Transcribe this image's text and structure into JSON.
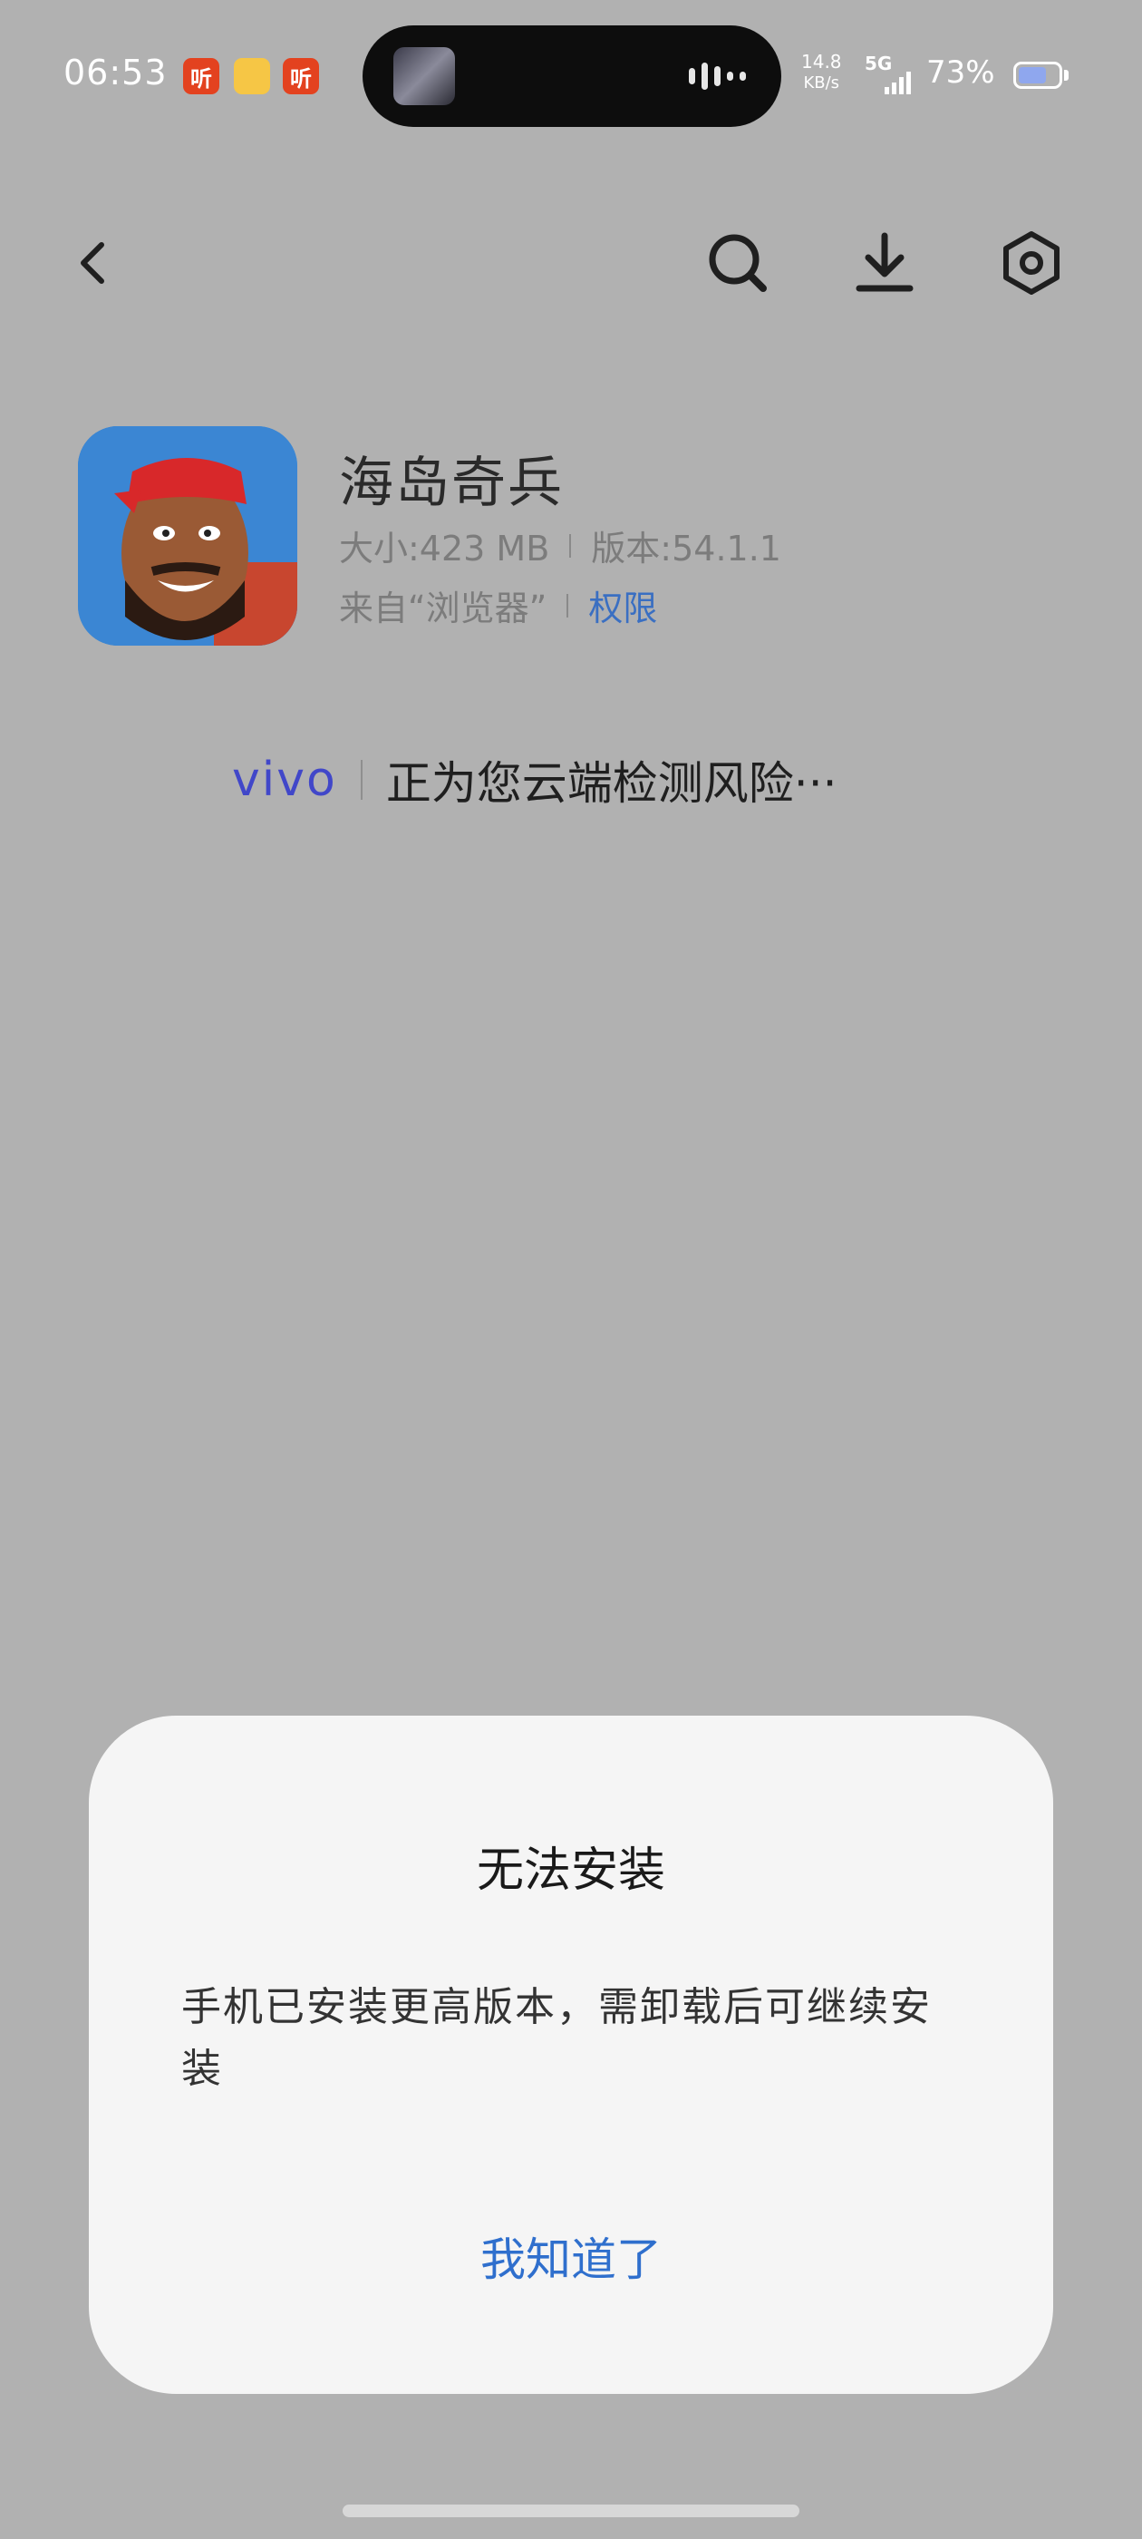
{
  "status_bar": {
    "time": "06:53",
    "notifications": [
      {
        "icon": "ting-app-icon",
        "label": "听"
      },
      {
        "icon": "note-app-icon",
        "label": ""
      },
      {
        "icon": "ting-app-icon",
        "label": "听"
      }
    ],
    "net_speed_value": "14.8",
    "net_speed_unit": "KB/s",
    "network": "5G",
    "battery_percent": "73%"
  },
  "header": {
    "back_icon": "chevron-left-icon",
    "search_icon": "search-icon",
    "download_icon": "download-icon",
    "settings_icon": "hex-settings-icon"
  },
  "app": {
    "name": "海岛奇兵",
    "size": "大小:423 MB",
    "version": "版本:54.1.1",
    "source": "来自“浏览器”",
    "permissions_label": "权限"
  },
  "scan": {
    "brand": "vivo",
    "status_text": "正为您云端检测风险···"
  },
  "dialog": {
    "title": "无法安装",
    "message": "手机已安装更高版本，需卸载后可继续安装",
    "ok_label": "我知道了"
  },
  "colors": {
    "background": "#b1b1b1",
    "dialog_bg": "#f5f5f5",
    "accent_blue": "#2f6fcd",
    "vivo_blue": "#4147c9"
  }
}
